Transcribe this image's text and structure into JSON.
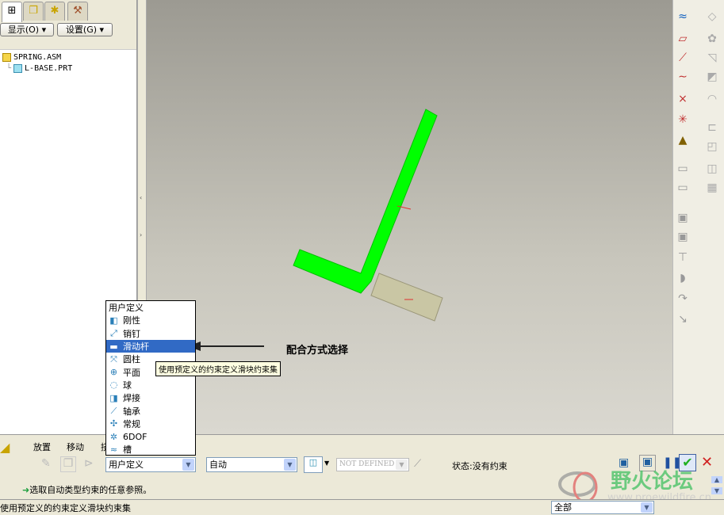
{
  "left_panel": {
    "tabs": [
      {
        "icon": "model-tree-icon"
      },
      {
        "icon": "layers-icon"
      },
      {
        "icon": "folder-star-icon"
      },
      {
        "icon": "tools-folder-icon"
      }
    ],
    "show_button": "显示(O) ▾",
    "settings_button": "设置(G) ▾",
    "tree": [
      {
        "label": "SPRING.ASM",
        "icon": "assembly-icon"
      },
      {
        "label": "L-BASE.PRT",
        "icon": "part-icon"
      }
    ]
  },
  "viewport": {
    "annotation": "配合方式选择"
  },
  "connection_menu": {
    "header": "用户定义",
    "items": [
      {
        "label": "刚性",
        "icon": "rigid-icon"
      },
      {
        "label": "销钉",
        "icon": "pin-icon"
      },
      {
        "label": "滑动杆",
        "icon": "slider-icon",
        "selected": true
      },
      {
        "label": "圆柱",
        "icon": "cylinder-icon"
      },
      {
        "label": "平面",
        "icon": "planar-icon"
      },
      {
        "label": "球",
        "icon": "ball-icon"
      },
      {
        "label": "焊接",
        "icon": "weld-icon"
      },
      {
        "label": "轴承",
        "icon": "bearing-icon"
      },
      {
        "label": "常规",
        "icon": "general-icon"
      },
      {
        "label": "6DOF",
        "icon": "6dof-icon"
      },
      {
        "label": "槽",
        "icon": "slot-icon"
      }
    ],
    "tooltip": "使用预定义的约束定义滑块约束集"
  },
  "dashboard": {
    "tabs": [
      "放置",
      "移动",
      "挠"
    ],
    "connection_type": "用户定义",
    "constraint_type": "自动",
    "offset": "NOT DEFINED",
    "status": "状态:没有约束",
    "prompt": "选取自动类型约束的任意参照。"
  },
  "statusbar": {
    "message": "使用预定义的约束定义滑块约束集",
    "filter": "全部"
  },
  "watermark": {
    "title": "野火论坛",
    "url": "www.proewildfire.cn"
  },
  "colors": {
    "part_green": "#00ff00",
    "selection": "#316ac5"
  }
}
